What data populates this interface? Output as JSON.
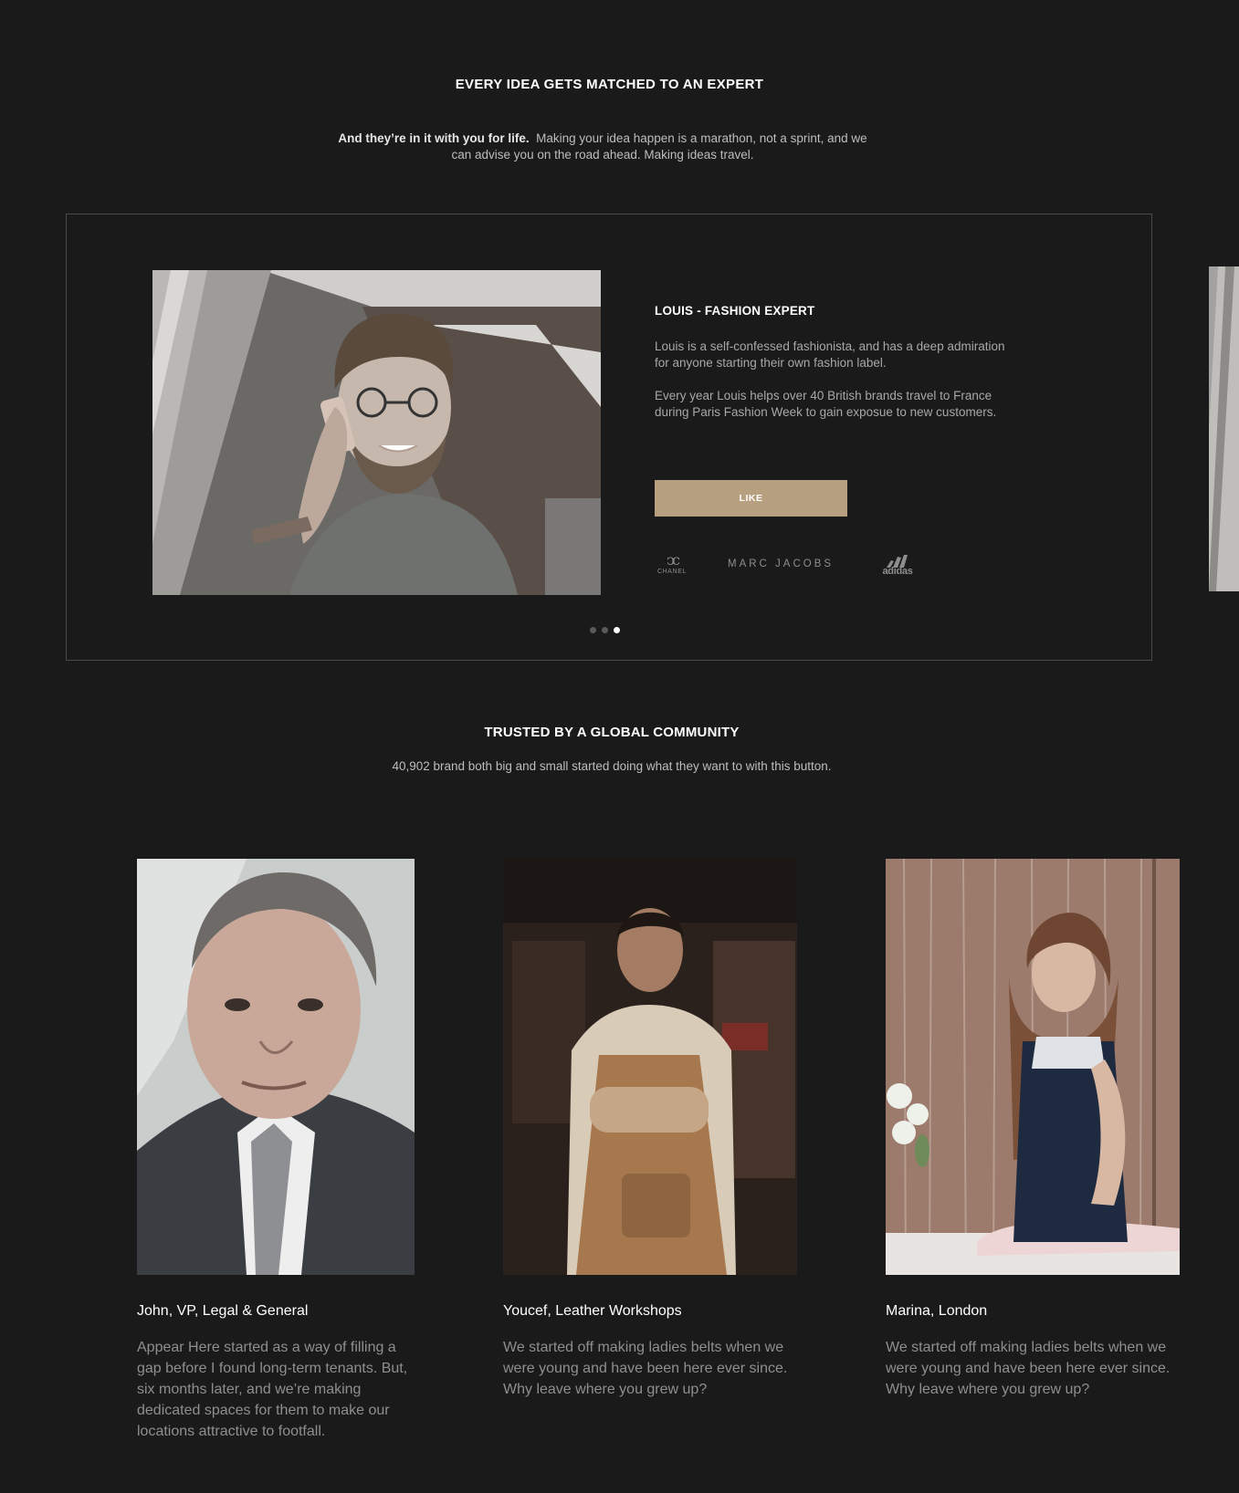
{
  "hero": {
    "title": "EVERY IDEA GETS MATCHED TO AN EXPERT",
    "subtitle_bold": "And they’re in it with you for life.",
    "subtitle_rest": "Making your idea happen is a marathon, not a sprint, and we can advise you on the road ahead.  Making ideas travel."
  },
  "expert": {
    "title": "LOUIS - FASHION EXPERT",
    "paragraph1": "Louis is a self-confessed fashionista, and has a deep admiration for anyone starting their own fashion label.",
    "paragraph2": "Every year Louis helps over 40 British brands travel to France during Paris Fashion Week to gain exposue to new customers.",
    "like_label": "LIKE",
    "brands": {
      "chanel": "CHANEL",
      "marc_jacobs": "MARC JACOBS",
      "adidas": "adidas"
    }
  },
  "carousel": {
    "slide_count": 3,
    "active_index": 3
  },
  "trusted": {
    "title": "TRUSTED BY A GLOBAL COMMUNITY",
    "subtitle": "40,902 brand both big and small started doing what they want to with this button."
  },
  "testimonials": [
    {
      "name": "John, VP, Legal & General",
      "quote": "Appear Here started as a way of filling a gap before I found long-term tenants. But, six months later, and we’re making dedicated spaces for them to make our locations attractive to footfall."
    },
    {
      "name": "Youcef, Leather Workshops",
      "quote": "We started off making ladies belts when we were young and have been here ever since. Why leave where you grew up?"
    },
    {
      "name": "Marina, London",
      "quote": "We started off making ladies belts when we were young and have been here ever since. Why leave where you grew up?"
    }
  ],
  "colors": {
    "background": "#1a1a1a",
    "accent_button": "#b7a07f",
    "border": "#4a4a4a"
  }
}
